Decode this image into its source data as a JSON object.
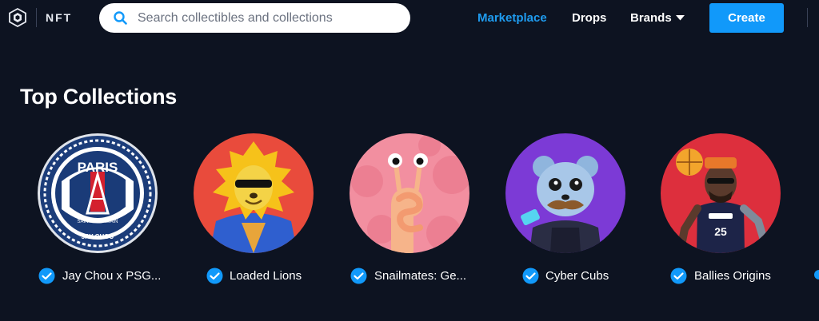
{
  "header": {
    "logo_icon": "crypto-com-shield-icon",
    "brand_label": "NFT",
    "search": {
      "placeholder": "Search collectibles and collections",
      "icon": "search-icon"
    },
    "nav": [
      {
        "label": "Marketplace",
        "active": true
      },
      {
        "label": "Drops",
        "active": false
      },
      {
        "label": "Brands",
        "active": false,
        "icon": "caret-down-icon"
      }
    ],
    "create_label": "Create"
  },
  "main": {
    "section_title": "Top Collections",
    "collections": [
      {
        "name": "Jay Chou x PSG...",
        "verified": true,
        "avatar": "psg-paris-saint-germain-crest"
      },
      {
        "name": "Loaded Lions",
        "verified": true,
        "avatar": "lion-with-sunglasses"
      },
      {
        "name": "Snailmates: Ge...",
        "verified": true,
        "avatar": "pink-snail"
      },
      {
        "name": "Cyber Cubs",
        "verified": true,
        "avatar": "bear-cub-with-mustache"
      },
      {
        "name": "Ballies Origins",
        "verified": true,
        "avatar": "basketball-player"
      }
    ]
  },
  "colors": {
    "background": "#0d1321",
    "accent": "#1199fa",
    "active_link": "#1f9cf0"
  }
}
